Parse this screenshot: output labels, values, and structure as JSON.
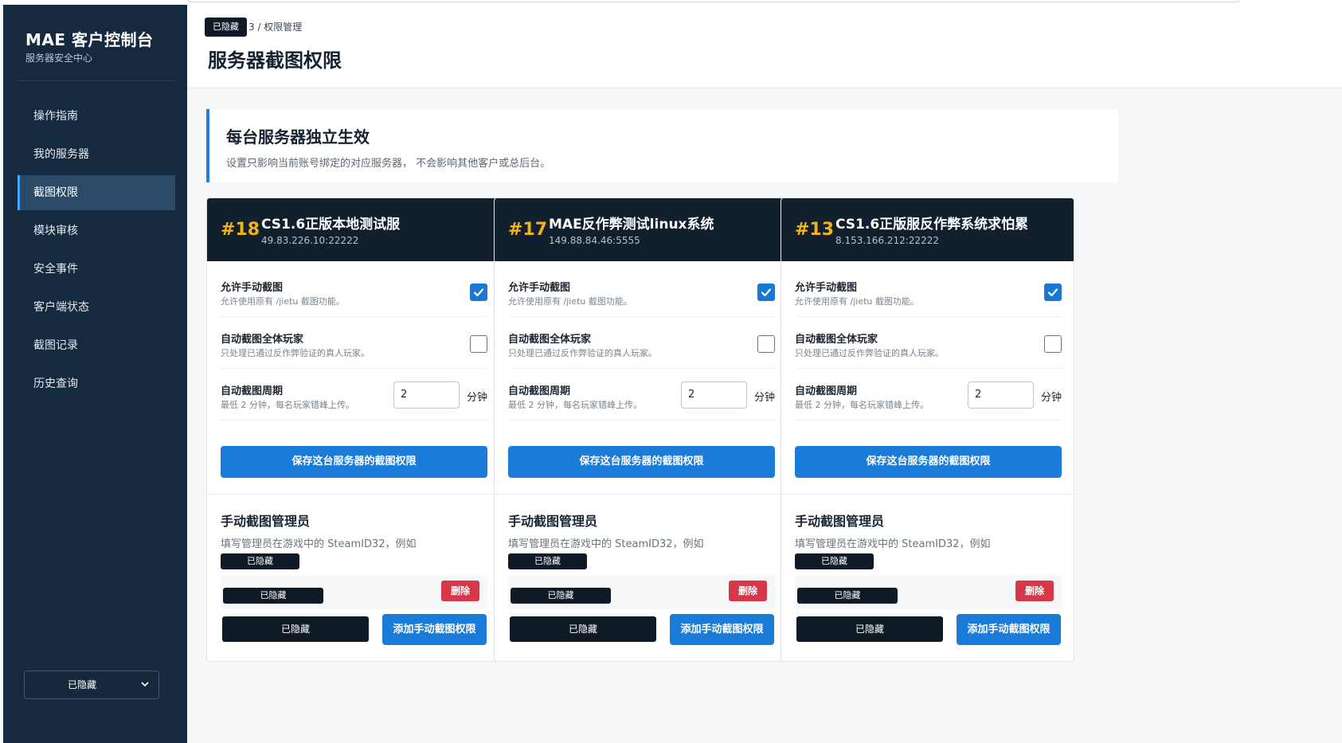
{
  "sidebar": {
    "brand_title": "MAE 客户控制台",
    "brand_subtitle": "服务器安全中心",
    "items": [
      {
        "label": "操作指南"
      },
      {
        "label": "我的服务器"
      },
      {
        "label": "截图权限",
        "active": true
      },
      {
        "label": "模块审核"
      },
      {
        "label": "安全事件"
      },
      {
        "label": "客户端状态"
      },
      {
        "label": "截图记录"
      },
      {
        "label": "历史查询"
      }
    ],
    "account_select": "已隐藏",
    "chevron_icon": "chevron-down-icon"
  },
  "header": {
    "breadcrumb_hidden": "已隐藏",
    "breadcrumb_tail": "3 / 权限管理",
    "title": "服务器截图权限"
  },
  "info": {
    "title": "每台服务器独立生效",
    "description": "设置只影响当前账号绑定的对应服务器， 不会影响其他客户或总后台。"
  },
  "cards": [
    {
      "number": "#18",
      "name": "CS1.6正版本地测试服",
      "address": "49.83.226.10:22222",
      "manual": {
        "title": "允许手动截图",
        "desc": "允许使用原有 /jietu 截图功能。",
        "checked": true
      },
      "auto": {
        "title": "自动截图全体玩家",
        "desc": "只处理已通过反作弊验证的真人玩家。",
        "checked": false
      },
      "period": {
        "title": "自动截图周期",
        "desc": "最低 2 分钟，每名玩家错峰上传。",
        "value": "2",
        "unit": "分钟"
      },
      "save_label": "保存这台服务器的截图权限",
      "admin_title": "手动截图管理员",
      "admin_desc": "填写管理员在游戏中的 SteamID32，例如",
      "admin_example": "已隐藏",
      "admin_entry": "已隐藏",
      "delete_label": "删除",
      "add_input": "已隐藏",
      "add_label": "添加手动截图权限"
    },
    {
      "number": "#17",
      "name": "MAE反作弊测试linux系统",
      "address": "149.88.84.46:5555",
      "manual": {
        "title": "允许手动截图",
        "desc": "允许使用原有 /jietu 截图功能。",
        "checked": true
      },
      "auto": {
        "title": "自动截图全体玩家",
        "desc": "只处理已通过反作弊验证的真人玩家。",
        "checked": false
      },
      "period": {
        "title": "自动截图周期",
        "desc": "最低 2 分钟，每名玩家错峰上传。",
        "value": "2",
        "unit": "分钟"
      },
      "save_label": "保存这台服务器的截图权限",
      "admin_title": "手动截图管理员",
      "admin_desc": "填写管理员在游戏中的 SteamID32，例如",
      "admin_example": "已隐藏",
      "admin_entry": "已隐藏",
      "delete_label": "删除",
      "add_input": "已隐藏",
      "add_label": "添加手动截图权限"
    },
    {
      "number": "#13",
      "name": "CS1.6正版服反作弊系统求怕累",
      "address": "8.153.166.212:22222",
      "manual": {
        "title": "允许手动截图",
        "desc": "允许使用原有 /jietu 截图功能。",
        "checked": true
      },
      "auto": {
        "title": "自动截图全体玩家",
        "desc": "只处理已通过反作弊验证的真人玩家。",
        "checked": false
      },
      "period": {
        "title": "自动截图周期",
        "desc": "最低 2 分钟，每名玩家错峰上传。",
        "value": "2",
        "unit": "分钟"
      },
      "save_label": "保存这台服务器的截图权限",
      "admin_title": "手动截图管理员",
      "admin_desc": "填写管理员在游戏中的 SteamID32，例如",
      "admin_example": "已隐藏",
      "admin_entry": "已隐藏",
      "delete_label": "删除",
      "add_input": "已隐藏",
      "add_label": "添加手动截图权限"
    }
  ],
  "colors": {
    "sidebar_bg": "#152a3e",
    "accent": "#1a7cd8",
    "card_number": "#f1b318",
    "danger": "#d6384a"
  }
}
